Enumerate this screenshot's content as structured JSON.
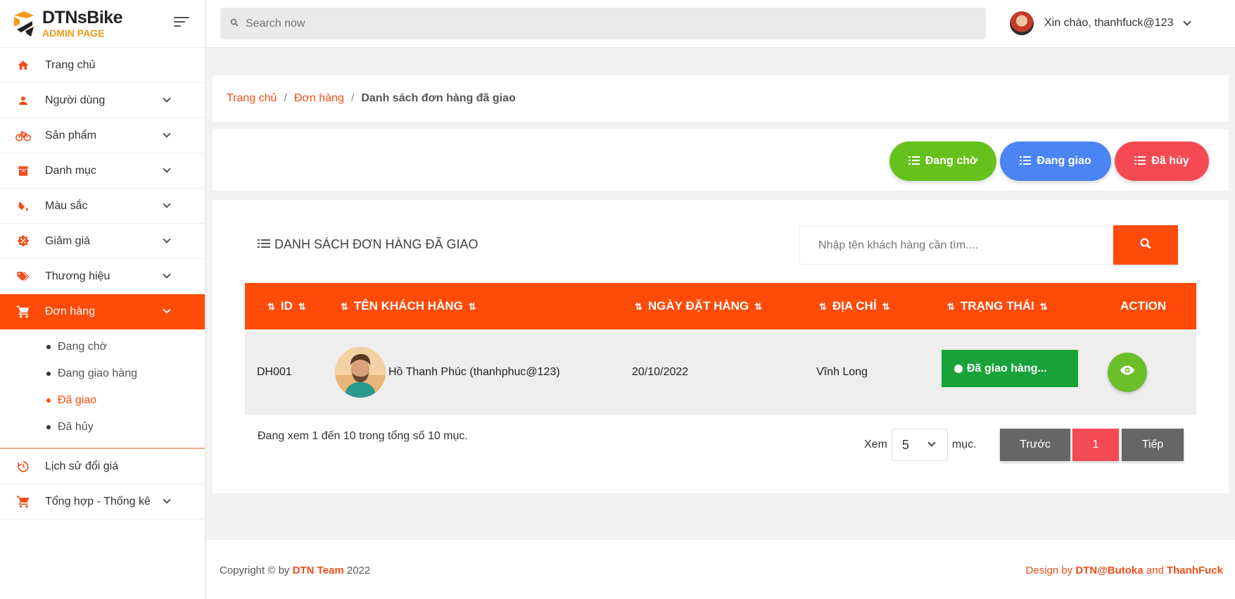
{
  "brand": {
    "name": "DTNsBike",
    "subtitle": "ADMIN PAGE"
  },
  "topbar": {
    "search_placeholder": "Search now",
    "greeting": "Xin chào, thanhfuck@123"
  },
  "sidebar": {
    "items": [
      {
        "label": "Trang chủ",
        "icon": "home-icon"
      },
      {
        "label": "Người dùng",
        "icon": "user-icon"
      },
      {
        "label": "Sản phẩm",
        "icon": "bicycle-icon"
      },
      {
        "label": "Danh mục",
        "icon": "archive-icon"
      },
      {
        "label": "Màu sắc",
        "icon": "paint-bucket-icon"
      },
      {
        "label": "Giảm giá",
        "icon": "discount-icon"
      },
      {
        "label": "Thương hiệu",
        "icon": "tag-icon"
      },
      {
        "label": "Đơn hàng",
        "icon": "cart-icon"
      },
      {
        "label": "Lịch sử đổi giá",
        "icon": "history-icon"
      },
      {
        "label": "Tổng hợp - Thống kê",
        "icon": "cart-icon"
      }
    ],
    "submenu": [
      "Đang chờ",
      "Đang giao hàng",
      "Đã giao",
      "Đã hủy"
    ]
  },
  "breadcrumb": {
    "home": "Trang chủ",
    "orders": "Đơn hàng",
    "current": "Danh sách đơn hàng đã giao",
    "sep": "/"
  },
  "filters": {
    "pending": "Đang chờ",
    "shipping": "Đang giao",
    "cancelled": "Đã hủy"
  },
  "list": {
    "title": "DANH SÁCH ĐƠN HÀNG ĐÃ GIAO",
    "search_placeholder": "Nhập tên khách hàng cần tìm....",
    "columns": {
      "id": "ID",
      "customer": "TÊN KHÁCH HÀNG",
      "date": "NGÀY ĐẶT HÀNG",
      "address": "ĐỊA CHỈ",
      "status": "TRẠNG THÁI",
      "action": "ACTION"
    },
    "rows": [
      {
        "id": "DH001",
        "customer": "Hồ Thanh Phúc (thanhphuc@123)",
        "date": "20/10/2022",
        "address": "Vĩnh Long",
        "status": "Đã giao hàng..."
      }
    ]
  },
  "pagination": {
    "info": "Đang xem 1 đến 10 trong tổng số 10 mục.",
    "show_label": "Xem",
    "per_page": "5",
    "items_label": "mục.",
    "prev": "Trước",
    "page": "1",
    "next": "Tiếp"
  },
  "footer": {
    "copyright_prefix": "Copyright © by",
    "team": "DTN Team",
    "year": "2022",
    "design_prefix": "Design by",
    "designer1": "DTN@Butoka",
    "and": "and",
    "designer2": "ThanhFuck"
  },
  "colors": {
    "accent": "#ff4b0a",
    "green": "#67c11d",
    "blue": "#4b84f4",
    "red": "#f64a52",
    "status_green": "#19a23a"
  }
}
